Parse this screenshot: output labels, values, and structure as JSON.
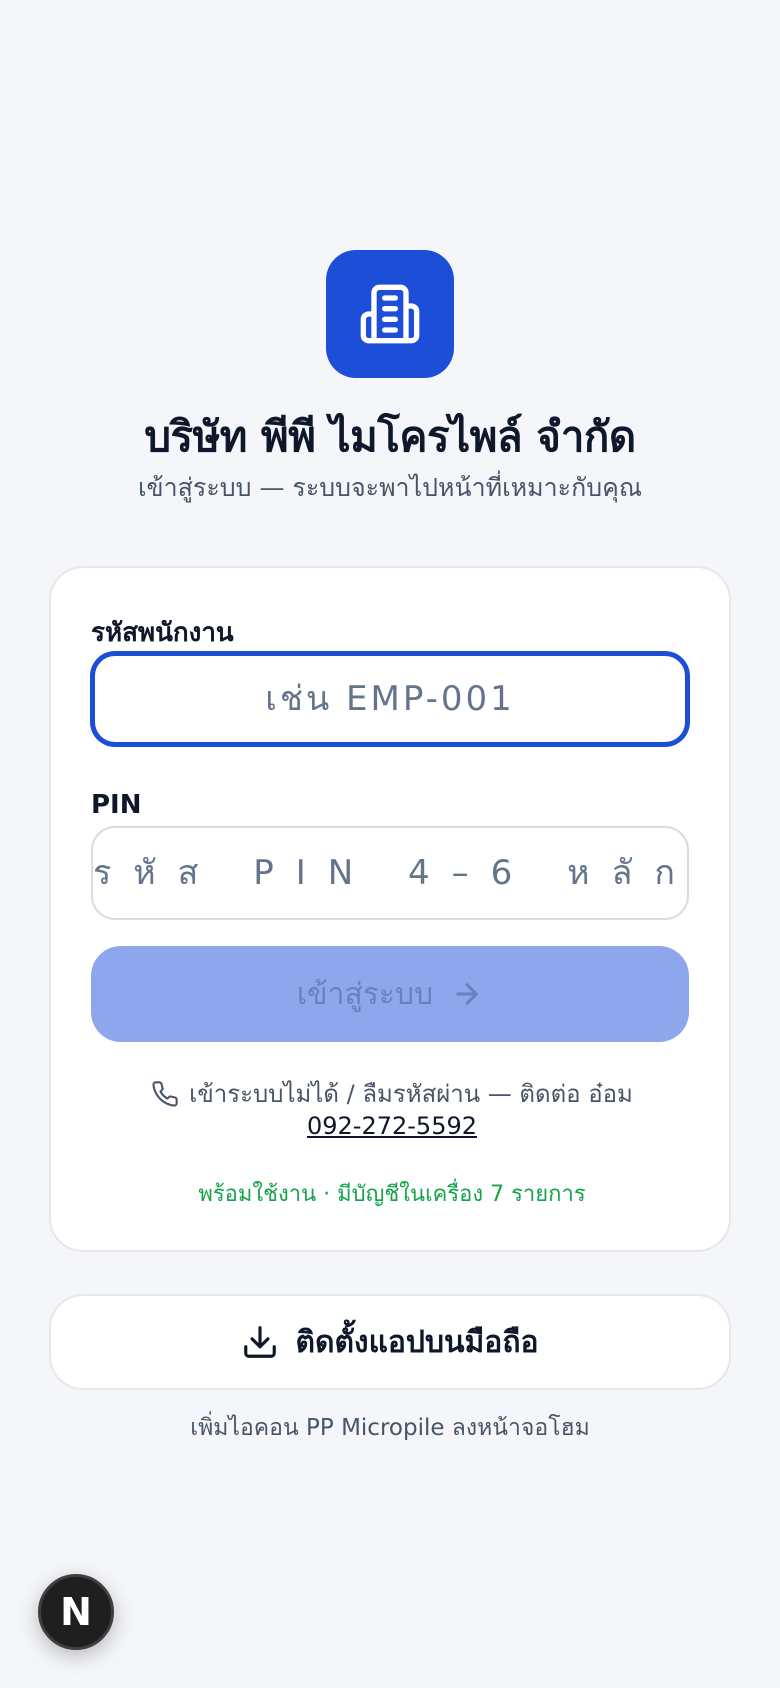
{
  "brand": {
    "company_name": "บริษัท พีพี ไมโครไพล์ จำกัด",
    "subtitle": "เข้าสู่ระบบ — ระบบจะพาไปหน้าที่เหมาะกับคุณ",
    "logo_icon": "building-icon",
    "accent_color": "#1d4ed8"
  },
  "login": {
    "employee_label": "รหัสพนักงาน",
    "employee_placeholder": "เช่น EMP-001",
    "employee_value": "",
    "pin_label": "PIN",
    "pin_placeholder": "รหัส PIN 4–6 หลัก",
    "pin_value": "",
    "submit_label": "เข้าสู่ระบบ",
    "submit_icon": "arrow-right-icon",
    "submit_disabled": true
  },
  "help": {
    "phone_icon": "phone-icon",
    "text": "เข้าระบบไม่ได้ / ลืมรหัสผ่าน — ติดต่อ อ๋อม",
    "phone_number": "092-272-5592"
  },
  "status": {
    "text": "พร้อมใช้งาน · มีบัญชีในเครื่อง 7 รายการ",
    "color": "#16a34a"
  },
  "install": {
    "icon": "download-icon",
    "label": "ติดตั้งแอปบนมือถือ",
    "hint": "เพิ่มไอคอน PP Micropile ลงหน้าจอโฮม"
  },
  "dev_badge": {
    "icon": "nextjs-logo-icon",
    "letter": "N"
  }
}
